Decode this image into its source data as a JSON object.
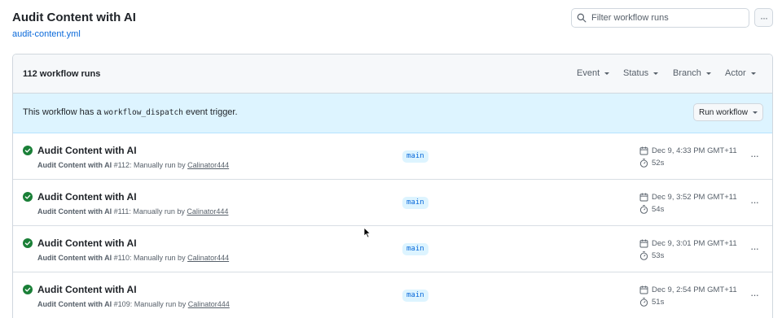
{
  "header": {
    "title": "Audit Content with AI",
    "workflow_file": "audit-content.yml"
  },
  "filter": {
    "placeholder": "Filter workflow runs",
    "icon": "search-icon",
    "more_icon": "kebab-horizontal-icon"
  },
  "runs_header": {
    "count_label": "112 workflow runs",
    "filters": [
      {
        "label": "Event"
      },
      {
        "label": "Status"
      },
      {
        "label": "Branch"
      },
      {
        "label": "Actor"
      }
    ]
  },
  "dispatch_banner": {
    "text_before": "This workflow has a ",
    "code": "workflow_dispatch",
    "text_after": " event trigger.",
    "button_label": "Run workflow"
  },
  "runs": [
    {
      "title": "Audit Content with AI",
      "run_name": "Audit Content with AI",
      "run_number": "#112",
      "trigger_text": ": Manually run by ",
      "actor": "Calinator444",
      "branch": "main",
      "date": "Dec 9, 4:33 PM GMT+11",
      "duration": "52s",
      "status": "success"
    },
    {
      "title": "Audit Content with AI",
      "run_name": "Audit Content with AI",
      "run_number": "#111",
      "trigger_text": ": Manually run by ",
      "actor": "Calinator444",
      "branch": "main",
      "date": "Dec 9, 3:52 PM GMT+11",
      "duration": "54s",
      "status": "success"
    },
    {
      "title": "Audit Content with AI",
      "run_name": "Audit Content with AI",
      "run_number": "#110",
      "trigger_text": ": Manually run by ",
      "actor": "Calinator444",
      "branch": "main",
      "date": "Dec 9, 3:01 PM GMT+11",
      "duration": "53s",
      "status": "success"
    },
    {
      "title": "Audit Content with AI",
      "run_name": "Audit Content with AI",
      "run_number": "#109",
      "trigger_text": ": Manually run by ",
      "actor": "Calinator444",
      "branch": "main",
      "date": "Dec 9, 2:54 PM GMT+11",
      "duration": "51s",
      "status": "success"
    }
  ],
  "colors": {
    "success": "#1a7f37",
    "link": "#0969da",
    "banner_bg": "#ddf4ff"
  }
}
